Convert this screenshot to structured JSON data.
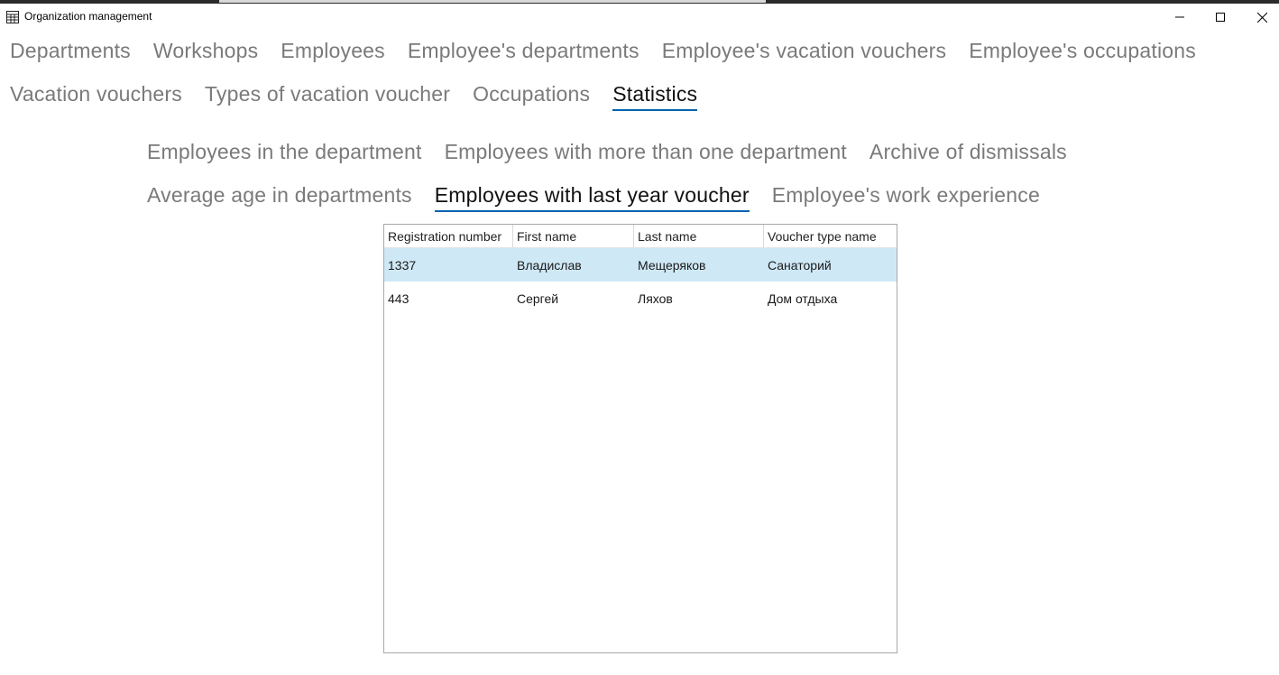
{
  "window": {
    "title": "Organization management",
    "icon": "grid-app-icon"
  },
  "main_tabs": [
    {
      "label": "Departments",
      "active": false
    },
    {
      "label": "Workshops",
      "active": false
    },
    {
      "label": "Employees",
      "active": false
    },
    {
      "label": "Employee's departments",
      "active": false
    },
    {
      "label": "Employee's vacation vouchers",
      "active": false
    },
    {
      "label": "Employee's occupations",
      "active": false
    },
    {
      "label": "Vacation vouchers",
      "active": false
    },
    {
      "label": "Types of vacation voucher",
      "active": false
    },
    {
      "label": "Occupations",
      "active": false
    },
    {
      "label": "Statistics",
      "active": true
    }
  ],
  "sub_tabs": [
    {
      "label": "Employees in the department",
      "active": false
    },
    {
      "label": "Employees with more than one department",
      "active": false
    },
    {
      "label": "Archive of dismissals",
      "active": false
    },
    {
      "label": "Average age in departments",
      "active": false
    },
    {
      "label": "Employees with last year voucher",
      "active": true
    },
    {
      "label": "Employee's work experience",
      "active": false
    }
  ],
  "table": {
    "columns": [
      "Registration number",
      "First name",
      "Last name",
      "Voucher type name"
    ],
    "rows": [
      {
        "cells": [
          "1337",
          "Владислав",
          "Мещеряков",
          "Санаторий"
        ],
        "selected": true
      },
      {
        "cells": [
          "443",
          "Сергей",
          "Ляхов",
          "Дом отдыха"
        ],
        "selected": false
      }
    ]
  },
  "colors": {
    "accent_underline": "#0063b1",
    "selected_row": "#cfe8f6",
    "inactive_tab_text": "#7a7a7a"
  }
}
